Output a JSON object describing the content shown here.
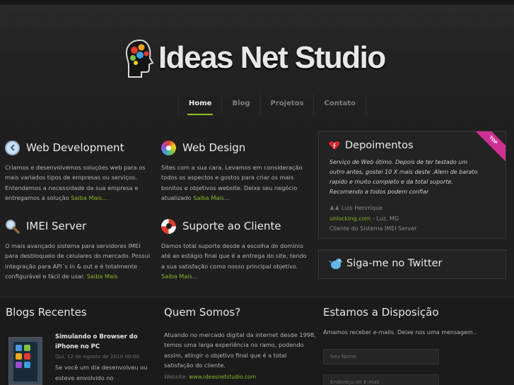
{
  "brand": {
    "name": "Ideas Net Studio"
  },
  "nav": [
    {
      "label": "Home",
      "active": true
    },
    {
      "label": "Blog",
      "active": false
    },
    {
      "label": "Projetos",
      "active": false
    },
    {
      "label": "Contato",
      "active": false
    }
  ],
  "services": [
    {
      "title": "Web Development",
      "icon": "clock-icon",
      "text": "Criamos e desenvolvemos soluções web para os mais variados tipos de empresas ou serviços. Entendemos a necessidade da sua empresa e entregamos a solução",
      "more": "Saiba Mais..."
    },
    {
      "title": "Web Design",
      "icon": "color-wheel-icon",
      "text": "Sites com a sua cara. Levamos em consideração todos os aspectos e gostos para criar os mais bonitos e objetivos website. Deixe seu negócio atualizado",
      "more": "Saiba Mais..."
    },
    {
      "title": "IMEI Server",
      "icon": "magnifier-icon",
      "text": "O mais avançado sistema para servidores IMEI para desbloqueio de celulares do mercado. Possui integração para API´s in & out e é totalmente configurável e fácil de usar.",
      "more": "Saiba Mais"
    },
    {
      "title": "Suporte ao Cliente",
      "icon": "lifebuoy-icon",
      "text": "Damos total suporte desde a escolha do domínio até ao estágio final que é a entrega do site, tendo a sua satisfação como nosso principal objetivo.",
      "more": "Saiba Mais..."
    }
  ],
  "testimonials": {
    "title": "Depoimentos",
    "ribbon": "TOP",
    "quote": "Serviço de Web ótimo. Depois de ter testado um outro antes, gostei 10 X mais deste .Alem de barato rapido e muito completo e da total suporte. Recomendo a todos podem confiar",
    "author": "Luis Henrrique",
    "site": "unlocking.com",
    "location": " - Luz, MG",
    "role": "Cliente do Sistema IMEI Server"
  },
  "twitter": {
    "title": "Siga-me no Twitter"
  },
  "footer": {
    "blogs_title": "Blogs Recentes",
    "post": {
      "title": "Simulando o Browser do iPhone no PC",
      "date": "Qui, 12 de Agosto de 2010 00:00",
      "excerpt": "Se você um dia desenvolveu ou esteve envolvido no"
    },
    "about_title": "Quem Somos?",
    "about_text": "Atuando no mercado digital da internet desde 1998, temos uma larga experiência no ramo, podendo assim, atingir o objetivo final que é a total satisfação do cliente.",
    "website_label": "Website: ",
    "website_url": "www.ideasnetstudio.com",
    "contact_title": "Estamos a Disposição",
    "contact_text": "Amamos receber e-mails. Deixe nos uma mensagem..",
    "name_placeholder": "Seu Nome",
    "email_placeholder": "Endereço de E-mail"
  },
  "colors": {
    "accent": "#8db326",
    "ribbon": "#d02f96",
    "background": "#1f1f1f"
  }
}
